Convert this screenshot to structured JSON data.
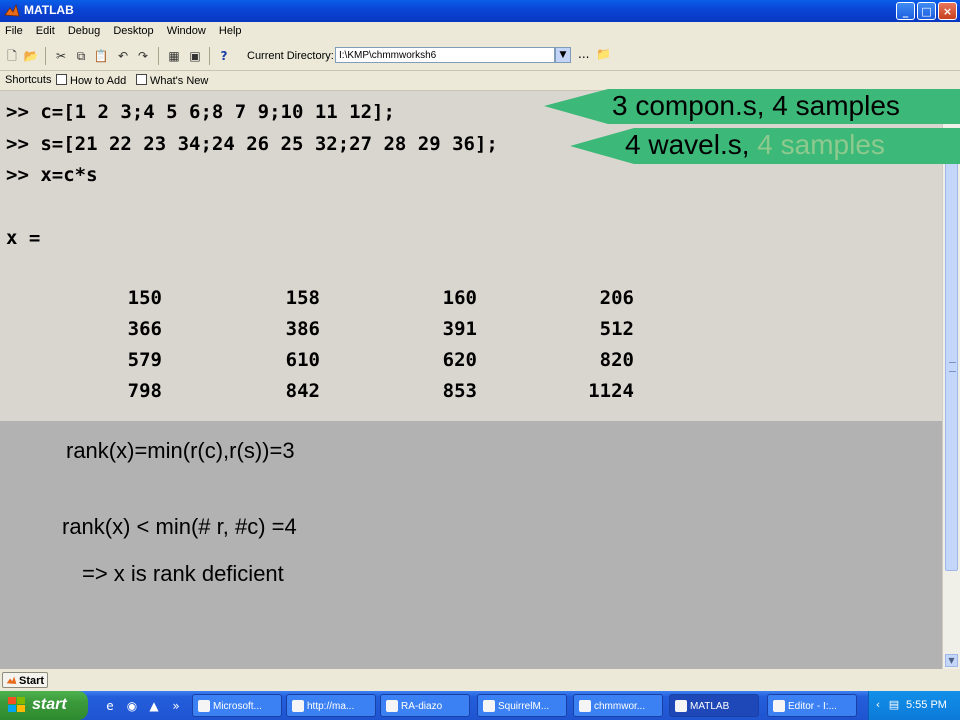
{
  "window": {
    "title": "MATLAB",
    "buttons": {
      "minimize": "_",
      "maximize": "□",
      "close": "×"
    }
  },
  "menu": [
    "File",
    "Edit",
    "Debug",
    "Desktop",
    "Window",
    "Help"
  ],
  "toolbar": {
    "current_directory_label": "Current Directory:",
    "current_directory_value": "I:\\KMP\\chmmworksh6",
    "browse": "..."
  },
  "shortcuts": {
    "shortcuts_label": "Shortcuts",
    "how_to_add": "How to Add",
    "whats_new": "What's New"
  },
  "command_window": {
    "lines": [
      ">> c=[1 2 3;4 5 6;8 7 9;10 11 12];",
      ">> s=[21 22 23 34;24 26 25 32;27 28 29 36];",
      ">> x=c*s",
      "x ="
    ],
    "matrix": [
      [
        "150",
        "158",
        "160",
        "206"
      ],
      [
        "366",
        "386",
        "391",
        "512"
      ],
      [
        "579",
        "610",
        "620",
        "820"
      ],
      [
        "798",
        "842",
        "853",
        "1124"
      ]
    ]
  },
  "notes": {
    "rank_eq": "rank(x)=min(r(c),r(s))=3",
    "rank_lt": "rank(x) < min(# r, #c) =4",
    "conclusion": "=> x is rank deficient"
  },
  "callouts": {
    "first": "3 compon.s, 4 samples",
    "second_main": "4 wavel.s, ",
    "second_faded": "4 samples",
    "color": "#3cb878"
  },
  "start_row": {
    "mini_start": "Start"
  },
  "taskbar": {
    "start": "start",
    "tasks": [
      {
        "label": "Microsoft..."
      },
      {
        "label": "http://ma..."
      },
      {
        "label": "RA-diazo"
      },
      {
        "label": "SquirrelM..."
      },
      {
        "label": "chmmwor..."
      },
      {
        "label": "MATLAB"
      },
      {
        "label": "Editor - I:..."
      }
    ],
    "clock": "5:55 PM"
  }
}
